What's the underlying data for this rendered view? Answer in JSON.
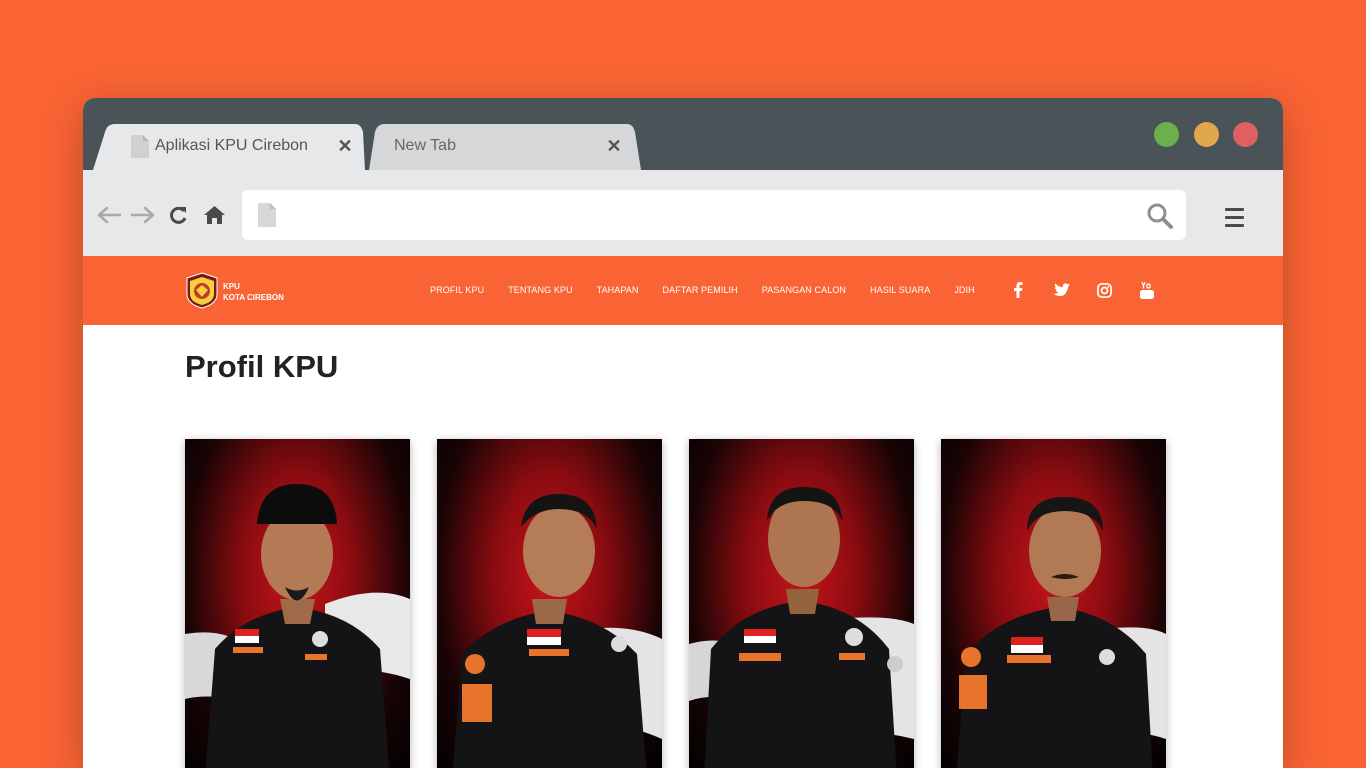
{
  "browser": {
    "tabs": [
      {
        "title": "Aplikasi KPU Cirebon",
        "close": "✕",
        "active": true
      },
      {
        "title": "New Tab",
        "close": "✕",
        "active": false
      }
    ],
    "window_controls": [
      {
        "name": "maximize",
        "color": "#6ab04c"
      },
      {
        "name": "minimize",
        "color": "#e0a84a"
      },
      {
        "name": "close",
        "color": "#e06060"
      }
    ],
    "address": {
      "value": "",
      "placeholder": ""
    }
  },
  "site": {
    "logo": {
      "line1": "KPU",
      "line2": "KOTA CIREBON",
      "emblem_text": "KOMISI PEMILIHAN UMUM"
    },
    "nav": [
      "PROFIL KPU",
      "TENTANG KPU",
      "TAHAPAN",
      "DAFTAR PEMILIH",
      "PASANGAN CALON",
      "HASIL SUARA",
      "JDIH"
    ],
    "social": [
      "facebook-icon",
      "twitter-icon",
      "instagram-icon",
      "youtube-icon"
    ],
    "accent": "#fa6434"
  },
  "page": {
    "title": "Profil KPU",
    "members": [
      {
        "photo": "member-photo-1"
      },
      {
        "photo": "member-photo-2"
      },
      {
        "photo": "member-photo-3"
      },
      {
        "photo": "member-photo-4"
      }
    ]
  }
}
